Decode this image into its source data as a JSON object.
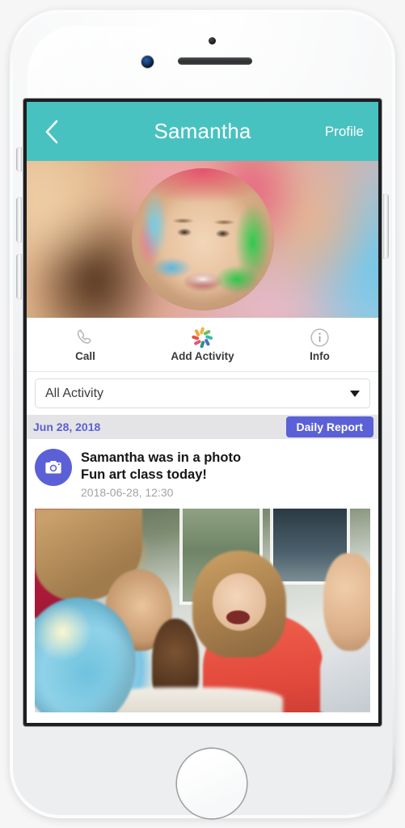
{
  "device": {
    "name": "white-smartphone-mockup",
    "sensors": {
      "camera": "front-camera",
      "speaker": "earpiece-grille",
      "proximity": "sensor-dot"
    },
    "buttons": {
      "silent": "silent-switch",
      "volume_up": "volume-up",
      "volume_down": "volume-down",
      "power": "power-button",
      "home": "home-button"
    }
  },
  "app": {
    "header": {
      "back_icon": "chevron-left-icon",
      "title": "Samantha",
      "action_label": "Profile",
      "background_color": "#48c2c0",
      "text_color": "#ffffff"
    },
    "hero": {
      "cover_description": "blurred classroom background",
      "avatar_description": "girl with face paint",
      "avatar_icon": "avatar"
    },
    "actions": [
      {
        "id": "call",
        "icon": "phone-handset-icon",
        "label": "Call"
      },
      {
        "id": "add-activity",
        "icon": "pinwheel-icon",
        "label": "Add Activity"
      },
      {
        "id": "info",
        "icon": "info-circle-icon",
        "label": "Info"
      }
    ],
    "pinwheel_colors": [
      "#f2b53c",
      "#6bbf59",
      "#3fb8b0",
      "#4a6fc4",
      "#2e8f8a",
      "#e8527a",
      "#e8503e",
      "#f2a33c"
    ],
    "filter": {
      "selected": "All Activity",
      "caret_icon": "chevron-down-icon",
      "options": [
        "All Activity"
      ]
    },
    "feed": {
      "date_group": {
        "date_label": "Jun 28, 2018",
        "date_color": "#5b60d6",
        "report_button_label": "Daily Report",
        "report_button_color": "#5b60d6"
      },
      "entries": [
        {
          "badge_icon": "camera-icon",
          "badge_color": "#5b60d6",
          "title": "Samantha was in a photo",
          "caption": "Fun art class today!",
          "timestamp": "2018-06-28, 12:30",
          "photo_description": "children looking at a globe in a classroom"
        }
      ]
    }
  }
}
